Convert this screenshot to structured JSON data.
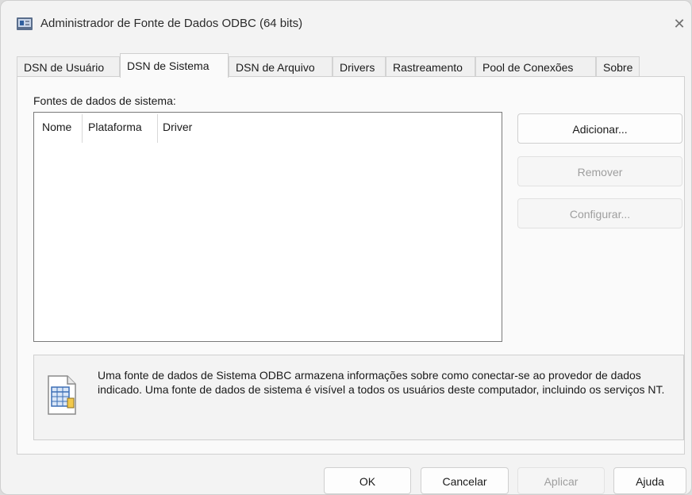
{
  "window": {
    "title": "Administrador de Fonte de Dados ODBC (64 bits)",
    "close_glyph": "✕"
  },
  "tabs": [
    {
      "label": "DSN de Usuário"
    },
    {
      "label": "DSN de Sistema",
      "active": true
    },
    {
      "label": "DSN de Arquivo"
    },
    {
      "label": "Drivers"
    },
    {
      "label": "Rastreamento"
    },
    {
      "label": "Pool de Conexões"
    },
    {
      "label": "Sobre"
    }
  ],
  "panel": {
    "section_label": "Fontes de dados de sistema:",
    "columns": [
      "Nome",
      "Plataforma",
      "Driver"
    ],
    "rows": []
  },
  "side_buttons": {
    "add": "Adicionar...",
    "remove": "Remover",
    "configure": "Configurar..."
  },
  "info": {
    "text": "Uma fonte de dados de Sistema ODBC armazena informações sobre como conectar-se ao provedor de dados indicado. Uma fonte de dados de sistema é visível a todos os usuários deste computador, incluindo os serviços NT."
  },
  "footer": {
    "ok": "OK",
    "cancel": "Cancelar",
    "apply": "Aplicar",
    "help": "Ajuda"
  },
  "icons": {
    "app": "odbc-admin-icon",
    "info": "database-document-icon",
    "close": "close-icon"
  }
}
